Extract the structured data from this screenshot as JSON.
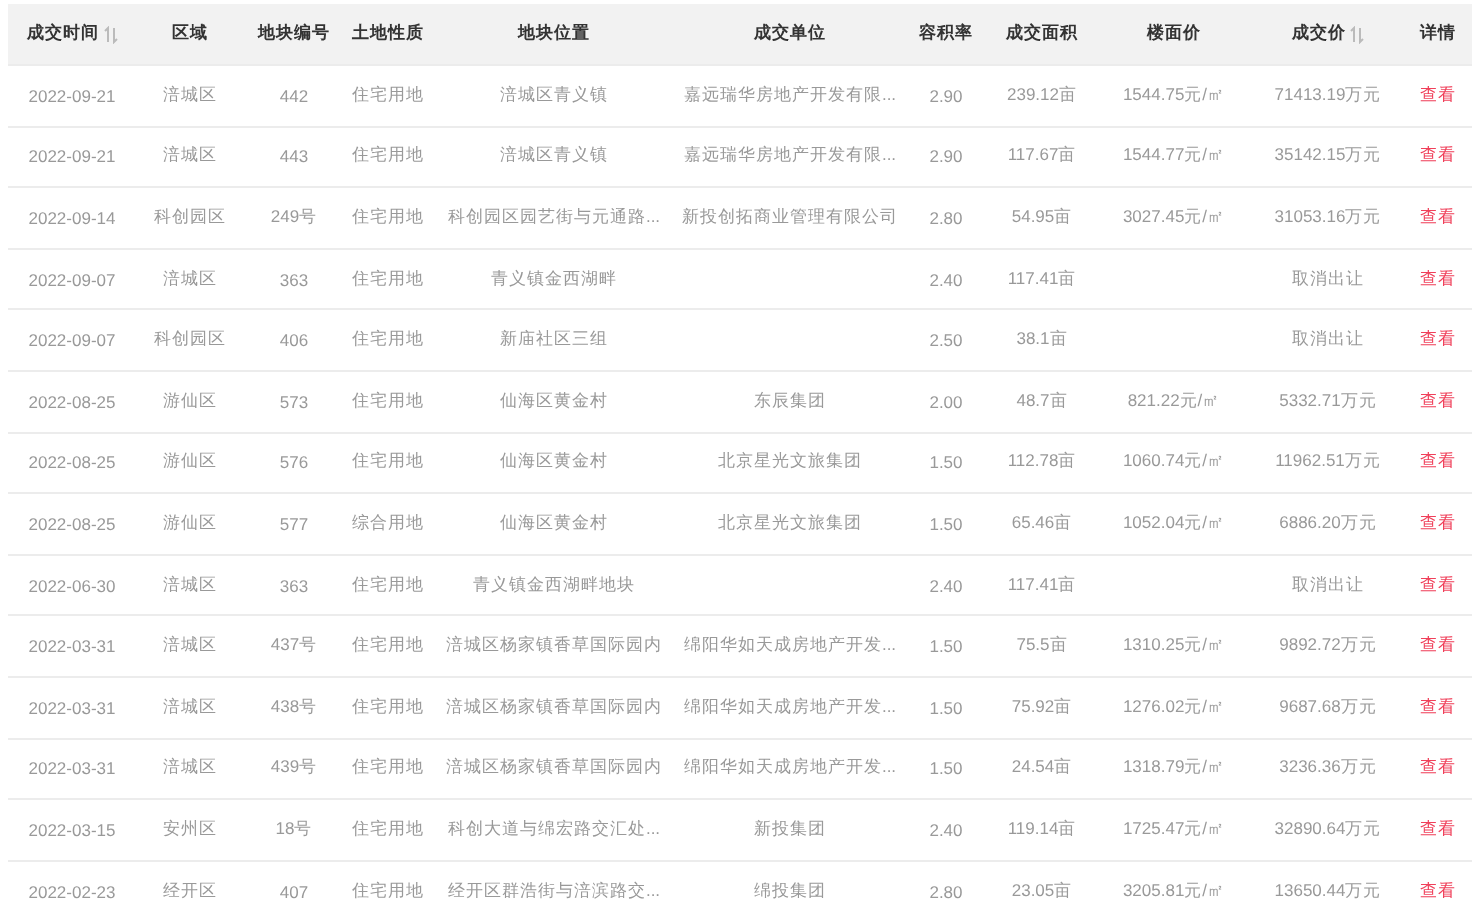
{
  "table": {
    "columns": [
      {
        "label": "成交时间",
        "sortable": true
      },
      {
        "label": "区域",
        "sortable": false
      },
      {
        "label": "地块编号",
        "sortable": false
      },
      {
        "label": "土地性质",
        "sortable": false
      },
      {
        "label": "地块位置",
        "sortable": false
      },
      {
        "label": "成交单位",
        "sortable": false
      },
      {
        "label": "容积率",
        "sortable": false
      },
      {
        "label": "成交面积",
        "sortable": false
      },
      {
        "label": "楼面价",
        "sortable": false
      },
      {
        "label": "成交价",
        "sortable": true
      },
      {
        "label": "详情",
        "sortable": false
      }
    ],
    "rows": [
      [
        "2022-09-21",
        "涪城区",
        "442",
        "住宅用地",
        "涪城区青义镇",
        "嘉远瑞华房地产开发有限...",
        "2.90",
        "239.12亩",
        "1544.75元/㎡",
        "71413.19万元",
        "查看"
      ],
      [
        "2022-09-21",
        "涪城区",
        "443",
        "住宅用地",
        "涪城区青义镇",
        "嘉远瑞华房地产开发有限...",
        "2.90",
        "117.67亩",
        "1544.77元/㎡",
        "35142.15万元",
        "查看"
      ],
      [
        "2022-09-14",
        "科创园区",
        "249号",
        "住宅用地",
        "科创园区园艺街与元通路...",
        "新投创拓商业管理有限公司",
        "2.80",
        "54.95亩",
        "3027.45元/㎡",
        "31053.16万元",
        "查看"
      ],
      [
        "2022-09-07",
        "涪城区",
        "363",
        "住宅用地",
        "青义镇金西湖畔",
        null,
        "2.40",
        "117.41亩",
        null,
        "取消出让",
        "查看"
      ],
      [
        "2022-09-07",
        "科创园区",
        "406",
        "住宅用地",
        "新庙社区三组",
        null,
        "2.50",
        "38.1亩",
        null,
        "取消出让",
        "查看"
      ],
      [
        "2022-08-25",
        "游仙区",
        "573",
        "住宅用地",
        "仙海区黄金村",
        "东辰集团",
        "2.00",
        "48.7亩",
        "821.22元/㎡",
        "5332.71万元",
        "查看"
      ],
      [
        "2022-08-25",
        "游仙区",
        "576",
        "住宅用地",
        "仙海区黄金村",
        "北京星光文旅集团",
        "1.50",
        "112.78亩",
        "1060.74元/㎡",
        "11962.51万元",
        "查看"
      ],
      [
        "2022-08-25",
        "游仙区",
        "577",
        "综合用地",
        "仙海区黄金村",
        "北京星光文旅集团",
        "1.50",
        "65.46亩",
        "1052.04元/㎡",
        "6886.20万元",
        "查看"
      ],
      [
        "2022-06-30",
        "涪城区",
        "363",
        "住宅用地",
        "青义镇金西湖畔地块",
        null,
        "2.40",
        "117.41亩",
        null,
        "取消出让",
        "查看"
      ],
      [
        "2022-03-31",
        "涪城区",
        "437号",
        "住宅用地",
        "涪城区杨家镇香草国际园内",
        "绵阳华如天成房地产开发...",
        "1.50",
        "75.5亩",
        "1310.25元/㎡",
        "9892.72万元",
        "查看"
      ],
      [
        "2022-03-31",
        "涪城区",
        "438号",
        "住宅用地",
        "涪城区杨家镇香草国际园内",
        "绵阳华如天成房地产开发...",
        "1.50",
        "75.92亩",
        "1276.02元/㎡",
        "9687.68万元",
        "查看"
      ],
      [
        "2022-03-31",
        "涪城区",
        "439号",
        "住宅用地",
        "涪城区杨家镇香草国际园内",
        "绵阳华如天成房地产开发...",
        "1.50",
        "24.54亩",
        "1318.79元/㎡",
        "3236.36万元",
        "查看"
      ],
      [
        "2022-03-15",
        "安州区",
        "18号",
        "住宅用地",
        "科创大道与绵宏路交汇处...",
        "新投集团",
        "2.40",
        "119.14亩",
        "1725.47元/㎡",
        "32890.64万元",
        "查看"
      ],
      [
        "2022-02-23",
        "经开区",
        "407",
        "住宅用地",
        "经开区群浩街与涪滨路交...",
        "绵投集团",
        "2.80",
        "23.05亩",
        "3205.81元/㎡",
        "13650.44万元",
        "查看"
      ]
    ]
  }
}
